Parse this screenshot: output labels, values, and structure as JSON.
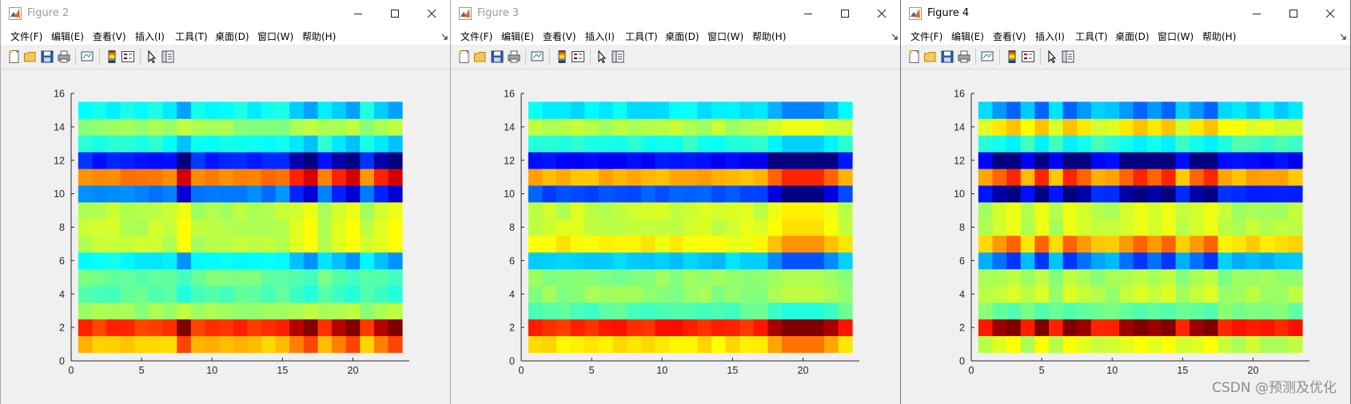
{
  "menu": [
    "文件(F)",
    "编辑(E)",
    "查看(V)",
    "插入(I)",
    "工具(T)",
    "桌面(D)",
    "窗口(W)",
    "帮助(H)"
  ],
  "windows": [
    {
      "title": "Figure 2",
      "active": false,
      "chart_data": {
        "type": "heatmap",
        "colormap": "jet",
        "x_ticks": [
          "0",
          "5",
          "10",
          "15",
          "20"
        ],
        "y_ticks": [
          "0",
          "2",
          "4",
          "6",
          "8",
          "10",
          "12",
          "14",
          "16"
        ],
        "xlim": [
          0,
          24
        ],
        "ylim": [
          0,
          16
        ],
        "columns": 23,
        "rows": 15,
        "row_base": [
          0.68,
          0.83,
          0.52,
          0.46,
          0.48,
          0.37,
          0.56,
          0.56,
          0.55,
          0.25,
          0.75,
          0.16,
          0.4,
          0.52,
          0.38
        ],
        "hot_columns": [
          8,
          17,
          20,
          23
        ],
        "warm_columns": [
          16,
          19,
          22
        ]
      }
    },
    {
      "title": "Figure 3",
      "active": false,
      "chart_data": {
        "type": "heatmap",
        "colormap": "jet",
        "x_ticks": [
          "0",
          "5",
          "10",
          "15",
          "20"
        ],
        "y_ticks": [
          "0",
          "2",
          "4",
          "6",
          "8",
          "10",
          "12",
          "14",
          "16"
        ],
        "xlim": [
          0,
          24
        ],
        "ylim": [
          0,
          16
        ],
        "columns": 23,
        "rows": 15,
        "row_base": [
          0.65,
          0.84,
          0.46,
          0.52,
          0.51,
          0.33,
          0.63,
          0.58,
          0.57,
          0.2,
          0.7,
          0.13,
          0.41,
          0.55,
          0.36
        ],
        "hot_columns": [
          19,
          20,
          21
        ],
        "warm_columns": [
          18,
          22
        ]
      }
    },
    {
      "title": "Figure 4",
      "active": true,
      "chart_data": {
        "type": "heatmap",
        "colormap": "jet",
        "x_ticks": [
          "0",
          "5",
          "10",
          "15",
          "20"
        ],
        "y_ticks": [
          "0",
          "2",
          "4",
          "6",
          "8",
          "10",
          "12",
          "14",
          "16"
        ],
        "xlim": [
          0,
          24
        ],
        "ylim": [
          0,
          16
        ],
        "columns": 23,
        "rows": 15,
        "row_base": [
          0.56,
          0.85,
          0.49,
          0.54,
          0.52,
          0.31,
          0.66,
          0.55,
          0.55,
          0.16,
          0.7,
          0.13,
          0.43,
          0.6,
          0.34
        ],
        "hot_columns": [
          3,
          5,
          7,
          12,
          14,
          17
        ],
        "warm_columns": [
          2,
          8,
          11,
          13,
          16
        ]
      }
    }
  ],
  "watermark": "CSDN @预测及优化"
}
